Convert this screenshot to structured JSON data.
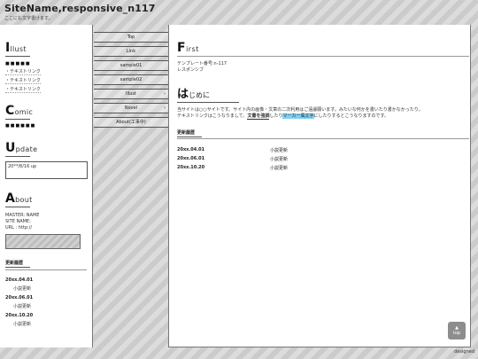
{
  "header": {
    "title": "SiteName,responsive_n117",
    "subtitle": "ここにも文字書けます。"
  },
  "sidebar": {
    "illust": {
      "cap": "I",
      "rest": "llust",
      "dots": "■■■■■",
      "links": [
        "・テキストリンク",
        "・テキストリンク",
        "・テキストリンク"
      ]
    },
    "comic": {
      "cap": "C",
      "rest": "omic",
      "dots": "■■■■■■"
    },
    "update": {
      "cap": "U",
      "rest": "pdate",
      "box_value": "20**/8/16 up"
    },
    "about": {
      "cap": "A",
      "rest": "bout",
      "lines": [
        "MASTER: NAME",
        "SITE NAME:",
        "URL : http://"
      ]
    },
    "changelog": {
      "title": "更新履歴",
      "entries": [
        {
          "date": "20xx.04.01",
          "text": "小説更新"
        },
        {
          "date": "20xx.06.01",
          "text": "小説更新"
        },
        {
          "date": "20xx.10.20",
          "text": "小説更新"
        }
      ]
    }
  },
  "nav": {
    "items": [
      {
        "label": "Top",
        "arrow": ""
      },
      {
        "label": "Link",
        "arrow": ""
      },
      {
        "label": "sample01",
        "arrow": ""
      },
      {
        "label": "sample02",
        "arrow": ""
      },
      {
        "label": "Illust",
        "arrow": "›"
      },
      {
        "label": "Novel",
        "arrow": "›"
      },
      {
        "label": "About(工事中)",
        "arrow": ""
      }
    ]
  },
  "main": {
    "first": {
      "cap": "F",
      "rest": "irst",
      "lines": [
        "テンプレート番号:n-117",
        "レスポンシブ"
      ]
    },
    "intro": {
      "cap": "は",
      "rest": "じめに",
      "line1": "当サイトは○○サイトです。サイト内の画像・文章の二次利用はご遠慮願います。みたいな何かを書いたり書かなかったり。",
      "line2_a": "テキストリンクはこうなりまして、",
      "emph": "文書を強調",
      "line2_b": "したり",
      "marker": "マーカー風文字",
      "line2_c": "にしたりするとこうなりますのです。"
    },
    "changelog": {
      "title": "更新履歴",
      "entries": [
        {
          "date": "20xx.04.01",
          "text": "小説更新"
        },
        {
          "date": "20xx.06.01",
          "text": "小説更新"
        },
        {
          "date": "20xx.10.20",
          "text": "小説更新"
        }
      ]
    }
  },
  "top_button": {
    "arrow": "▲",
    "label": "top"
  },
  "footer": {
    "credit": "designed"
  }
}
